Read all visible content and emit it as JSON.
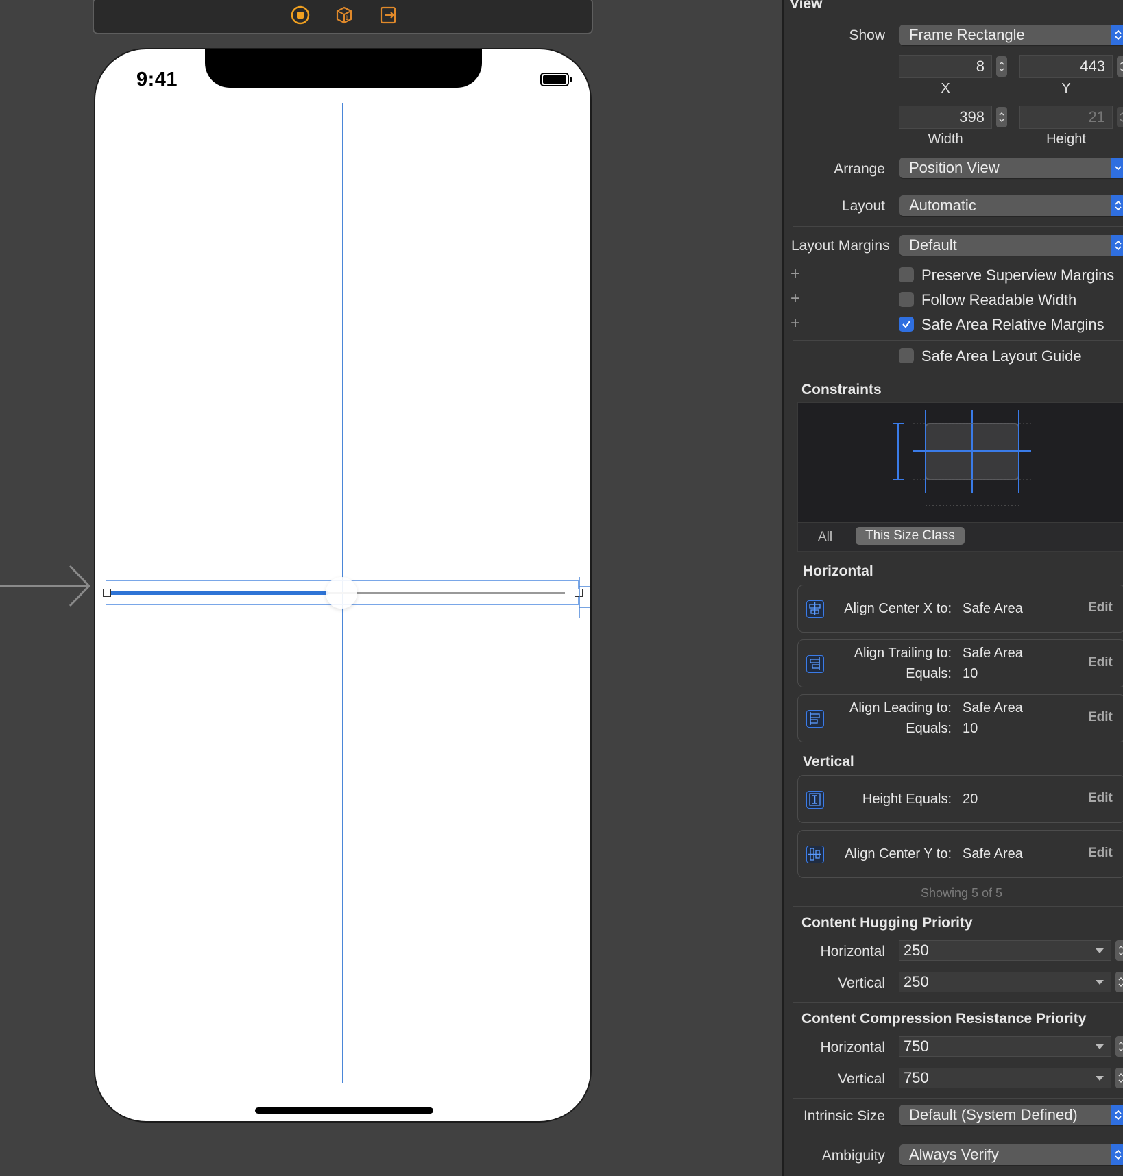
{
  "canvas": {
    "status_time": "9:41",
    "scene_icons": [
      "view-controller-icon",
      "first-responder-icon",
      "exit-icon"
    ]
  },
  "inspector": {
    "view_title": "View",
    "show": {
      "label": "Show",
      "value": "Frame Rectangle"
    },
    "frame": {
      "x": {
        "value": "8",
        "label": "X"
      },
      "y": {
        "value": "443",
        "label": "Y"
      },
      "width": {
        "value": "398",
        "label": "Width"
      },
      "height": {
        "value": "21",
        "label": "Height"
      }
    },
    "arrange": {
      "label": "Arrange",
      "value": "Position View"
    },
    "layout": {
      "label": "Layout",
      "value": "Automatic"
    },
    "layout_margins": {
      "label": "Layout Margins",
      "value": "Default"
    },
    "checkboxes": {
      "preserve_superview": {
        "label": "Preserve Superview Margins",
        "checked": false
      },
      "follow_readable": {
        "label": "Follow Readable Width",
        "checked": false
      },
      "safe_area_relative": {
        "label": "Safe Area Relative Margins",
        "checked": true
      },
      "safe_area_guide": {
        "label": "Safe Area Layout Guide",
        "checked": false
      }
    },
    "constraints": {
      "title": "Constraints",
      "seg_all": "All",
      "seg_size_class": "This Size Class",
      "horizontal_title": "Horizontal",
      "vertical_title": "Vertical",
      "horizontal": [
        {
          "line1_key": "Align Center X to:",
          "line1_val": "Safe Area",
          "line2_key": "",
          "line2_val": "",
          "edit": "Edit",
          "icon": "align-center-x-icon"
        },
        {
          "line1_key": "Align Trailing to:",
          "line1_val": "Safe Area",
          "line2_key": "Equals:",
          "line2_val": "10",
          "edit": "Edit",
          "icon": "align-trailing-icon"
        },
        {
          "line1_key": "Align Leading to:",
          "line1_val": "Safe Area",
          "line2_key": "Equals:",
          "line2_val": "10",
          "edit": "Edit",
          "icon": "align-leading-icon"
        }
      ],
      "vertical": [
        {
          "line1_key": "Height Equals:",
          "line1_val": "20",
          "edit": "Edit",
          "icon": "height-constraint-icon"
        },
        {
          "line1_key": "Align Center Y to:",
          "line1_val": "Safe Area",
          "edit": "Edit",
          "icon": "align-center-y-icon"
        }
      ],
      "showing": "Showing 5 of 5"
    },
    "hugging": {
      "title": "Content Hugging Priority",
      "horizontal_label": "Horizontal",
      "horizontal_value": "250",
      "vertical_label": "Vertical",
      "vertical_value": "250"
    },
    "compression": {
      "title": "Content Compression Resistance Priority",
      "horizontal_label": "Horizontal",
      "horizontal_value": "750",
      "vertical_label": "Vertical",
      "vertical_value": "750"
    },
    "intrinsic_size": {
      "label": "Intrinsic Size",
      "value": "Default (System Defined)"
    },
    "ambiguity": {
      "label": "Ambiguity",
      "value": "Always Verify"
    }
  }
}
